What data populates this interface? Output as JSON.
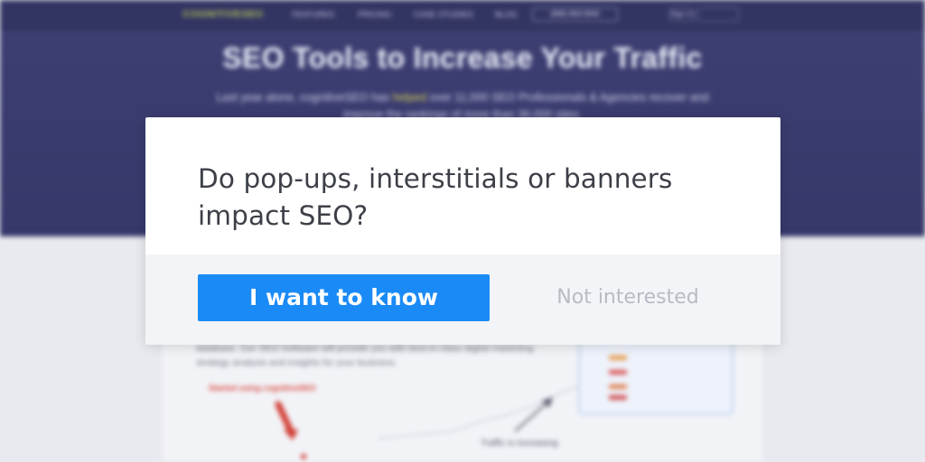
{
  "background_page": {
    "logo_text": "COGNITIVESEO",
    "nav_items": [
      "FEATURES",
      "PRICING",
      "CASE STUDIES",
      "BLOG"
    ],
    "nav_phone": "(888) 869-9940",
    "nav_login": "Sign In",
    "hero_title": "SEO Tools to Increase Your Traffic",
    "hero_subtitle_part1": "Last year alone, cognitiveSEO has ",
    "hero_subtitle_highlight": "helped",
    "hero_subtitle_part2": " over 11,000 SEO Professionals & Agencies recover and improve the rankings of more than 36,000 sites.",
    "content_paragraph": "database. Our SEO Software will provide you with best-in-class digital marketing strategy analysis and insights for your business.",
    "red_label": "Started using cognitiveSEO",
    "traffic_label": "Traffic is increasing",
    "brand_color": "#b4c35a",
    "hero_color": "#3d3f73"
  },
  "modal": {
    "question": "Do pop-ups, interstitials or banners impact SEO?",
    "primary_button_label": "I want to know",
    "secondary_link_label": "Not interested",
    "primary_color": "#1a8bf6",
    "footer_background": "#f3f4f8"
  }
}
